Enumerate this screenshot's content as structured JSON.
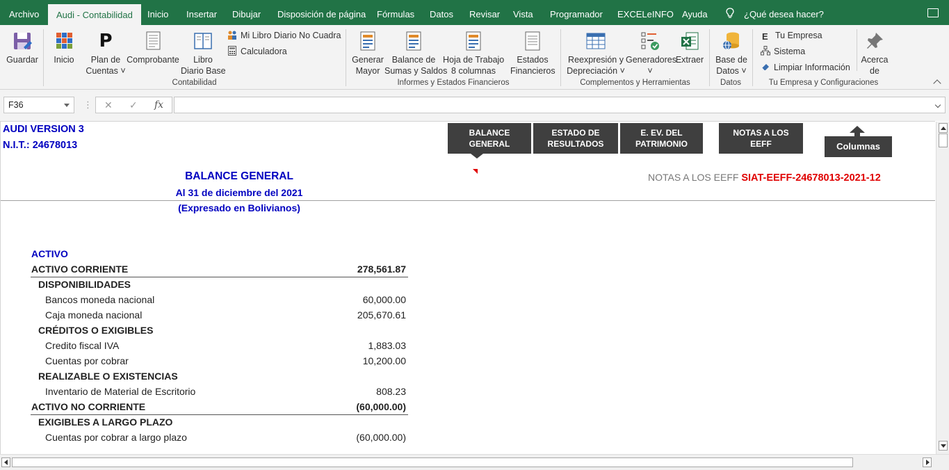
{
  "menu": {
    "tabs": [
      "Archivo",
      "Audi - Contabilidad",
      "Inicio",
      "Insertar",
      "Dibujar",
      "Disposición de página",
      "Fórmulas",
      "Datos",
      "Revisar",
      "Vista",
      "Programador",
      "EXCELeINFO",
      "Ayuda"
    ],
    "active_tab": "Audi - Contabilidad",
    "help_placeholder": "¿Qué desea hacer?"
  },
  "ribbon": {
    "guardar": "Guardar",
    "inicio": "Inicio",
    "plan_cuentas_1": "Plan de",
    "plan_cuentas_2": "Cuentas",
    "comprobante": "Comprobante",
    "libro_diario_1": "Libro",
    "libro_diario_2": "Diario Base",
    "mi_libro": "Mi Libro Diario No Cuadra",
    "calculadora": "Calculadora",
    "group_contabilidad": "Contabilidad",
    "generar_mayor_1": "Generar",
    "generar_mayor_2": "Mayor",
    "balance_sumas_1": "Balance de",
    "balance_sumas_2": "Sumas y Saldos",
    "hoja_trabajo_1": "Hoja de Trabajo",
    "hoja_trabajo_2": "8 columnas",
    "estados_fin_1": "Estados",
    "estados_fin_2": "Financieros",
    "group_informes": "Informes y Estados Financieros",
    "reexpresion_1": "Reexpresión y",
    "reexpresion_2": "Depreciación",
    "generadores": "Generadores",
    "extraer": "Extraer",
    "group_complementos": "Complementos y Herramientas",
    "base_datos_1": "Base de",
    "base_datos_2": "Datos",
    "group_datos": "Datos",
    "tu_empresa": "Tu Empresa",
    "sistema": "Sistema",
    "limpiar": "Limpiar Información",
    "group_empresa": "Tu Empresa y Configuraciones",
    "acerca_1": "Acerca",
    "acerca_2": "de"
  },
  "formula_bar": {
    "cell_ref": "F36",
    "formula": ""
  },
  "sheet": {
    "company": "AUDI VERSION 3",
    "nit": "N.I.T.: 24678013",
    "nav": {
      "balance_1": "BALANCE",
      "balance_2": "GENERAL",
      "resultados_1": "ESTADO DE",
      "resultados_2": "RESULTADOS",
      "patrimonio_1": "E. EV. DEL",
      "patrimonio_2": "PATRIMONIO",
      "notas_1": "NOTAS A LOS",
      "notas_2": "EEFF",
      "columnas": "Columnas"
    },
    "title": "BALANCE GENERAL",
    "date": "Al 31 de diciembre del 2021",
    "currency": "(Expresado en Bolivianos)",
    "notes_label": "NOTAS A LOS EEFF",
    "notes_code": "SIAT-EEFF-24678013-2021-12",
    "rows": [
      {
        "label": "ACTIVO",
        "amount": "",
        "style": "section"
      },
      {
        "label": "ACTIVO CORRIENTE",
        "amount": "278,561.87",
        "style": "total"
      },
      {
        "label": "DISPONIBILIDADES",
        "amount": "",
        "style": "group"
      },
      {
        "label": "Bancos moneda nacional",
        "amount": "60,000.00",
        "style": "item"
      },
      {
        "label": "Caja moneda nacional",
        "amount": "205,670.61",
        "style": "item"
      },
      {
        "label": "CRÉDITOS O EXIGIBLES",
        "amount": "",
        "style": "group"
      },
      {
        "label": "Credito fiscal IVA",
        "amount": "1,883.03",
        "style": "item"
      },
      {
        "label": "Cuentas por cobrar",
        "amount": "10,200.00",
        "style": "item"
      },
      {
        "label": "REALIZABLE O EXISTENCIAS",
        "amount": "",
        "style": "group"
      },
      {
        "label": "Inventario de Material de Escritorio",
        "amount": "808.23",
        "style": "item"
      },
      {
        "label": "ACTIVO NO CORRIENTE",
        "amount": "(60,000.00)",
        "style": "total"
      },
      {
        "label": "EXIGIBLES A LARGO PLAZO",
        "amount": "",
        "style": "group"
      },
      {
        "label": "Cuentas por cobrar a largo plazo",
        "amount": "(60,000.00)",
        "style": "item"
      }
    ]
  }
}
